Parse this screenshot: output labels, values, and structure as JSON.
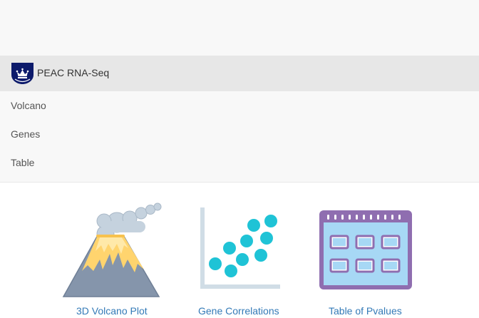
{
  "brand": {
    "title": "PEAC RNA-Seq",
    "logo_icon": "crown-shield-icon"
  },
  "nav": {
    "items": [
      {
        "label": "Volcano"
      },
      {
        "label": "Genes"
      },
      {
        "label": "Table"
      }
    ]
  },
  "tiles": [
    {
      "label": "3D Volcano Plot",
      "icon": "volcano-icon"
    },
    {
      "label": "Gene Correlations",
      "icon": "scatter-plot-icon"
    },
    {
      "label": "Table of Pvalues",
      "icon": "calendar-table-icon"
    }
  ],
  "colors": {
    "navbar_bg": "#f8f8f8",
    "brand_bar_bg": "#e7e7e7",
    "link": "#337ab7",
    "logo_navy": "#0c1a6b",
    "scatter_dots": "#1fc3d6",
    "table_purple": "#8f6eb0",
    "table_fill": "#a7d8f5",
    "volcano_gray": "#8595ab",
    "lava_yellow": "#ffd46e",
    "smoke": "#c5d2de"
  }
}
